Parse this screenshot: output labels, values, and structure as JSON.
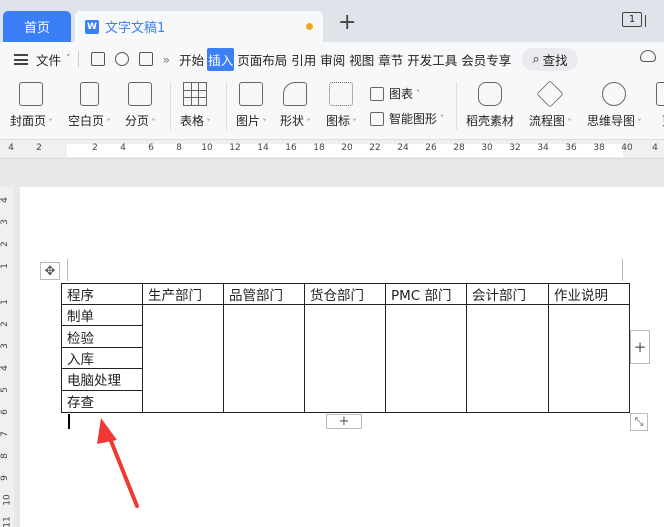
{
  "tabs": {
    "home": "首页",
    "doc_title": "文字文稿1",
    "doc_icon": "W",
    "window_count": "1"
  },
  "menu": {
    "file": "文件",
    "more": "»",
    "items": [
      "开始",
      "插入",
      "页面布局",
      "引用",
      "审阅",
      "视图",
      "章节",
      "开发工具",
      "会员专享"
    ],
    "active_index": 1,
    "search": "查找"
  },
  "ribbon": {
    "cover": "封面页",
    "blank": "空白页",
    "section_break": "分页",
    "table": "表格",
    "picture": "图片",
    "shape": "形状",
    "icon": "图标",
    "chart": "图表",
    "smart_shape": "智能图形",
    "docer": "稻壳素材",
    "flowchart": "流程图",
    "mindmap": "思维导图",
    "more": "更"
  },
  "ruler": {
    "h_ticks": [
      "4",
      "2",
      "2",
      "4",
      "6",
      "8",
      "10",
      "12",
      "14",
      "16",
      "18",
      "20",
      "22",
      "24",
      "26",
      "28",
      "30",
      "32",
      "34",
      "36",
      "38",
      "40",
      "4"
    ],
    "v_ticks": [
      "4",
      "3",
      "2",
      "1",
      "1",
      "2",
      "3",
      "4",
      "5",
      "6",
      "7",
      "8",
      "9",
      "10",
      "11"
    ]
  },
  "table": {
    "headers": [
      "程序",
      "生产部门",
      "品管部门",
      "货仓部门",
      "PMC 部门",
      "会计部门",
      "作业说明"
    ],
    "steps": [
      "制单",
      "检验",
      "入库",
      "电脑处理",
      "存查"
    ]
  },
  "handles": {
    "move": "✥",
    "add": "+",
    "resize": "⤡"
  },
  "colors": {
    "accent": "#3a7ff6",
    "arrow": "#ee3a36",
    "unsaved_dot": "#f5a623"
  }
}
